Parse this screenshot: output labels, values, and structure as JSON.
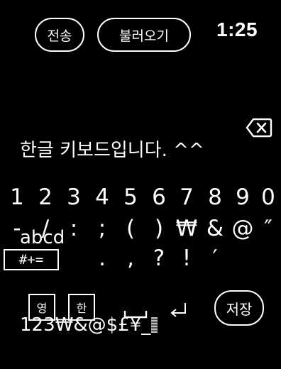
{
  "header": {
    "send_label": "전송",
    "load_label": "불러오기",
    "time": "1:25"
  },
  "editor": {
    "lines": [
      "한글 키보드입니다. ^^",
      "abcd",
      "123₩&@$£¥_"
    ]
  },
  "keyboard": {
    "digits": [
      "1",
      "2",
      "3",
      "4",
      "5",
      "6",
      "7",
      "8",
      "9",
      "0"
    ],
    "symbols_row1": [
      "-",
      "/",
      ":",
      ";",
      "(",
      ")",
      "₩",
      "&",
      "@",
      "″"
    ],
    "symbols_row2": [
      ".",
      ",",
      "?",
      "!",
      "′"
    ],
    "shift_label": "#+=",
    "eng_label": "영",
    "kor_label": "한",
    "save_label": "저장",
    "space_icon": "space-icon",
    "enter_icon": "return-icon",
    "backspace_icon": "backspace-icon"
  }
}
